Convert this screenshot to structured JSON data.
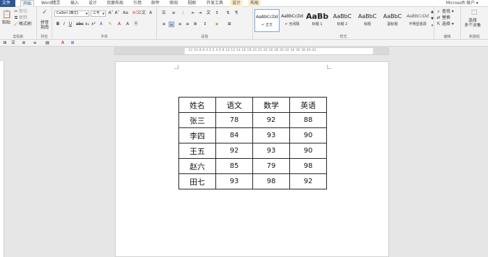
{
  "tabs": [
    {
      "label": "文件",
      "kind": "file"
    },
    {
      "label": "开始",
      "kind": "active"
    },
    {
      "label": "Word精灵",
      "kind": ""
    },
    {
      "label": "插入",
      "kind": ""
    },
    {
      "label": "设计",
      "kind": ""
    },
    {
      "label": "页面布局",
      "kind": ""
    },
    {
      "label": "引用",
      "kind": ""
    },
    {
      "label": "邮件",
      "kind": ""
    },
    {
      "label": "审阅",
      "kind": ""
    },
    {
      "label": "视图",
      "kind": ""
    },
    {
      "label": "开发工具",
      "kind": ""
    },
    {
      "label": "设计",
      "kind": "ctx"
    },
    {
      "label": "布局",
      "kind": "ctx"
    }
  ],
  "account": "Microsoft 帐户 ▾",
  "clipboard": {
    "paste": "粘贴",
    "cut": "剪切",
    "copy": "复制",
    "format_painter": "格式刷",
    "group": "剪贴板"
  },
  "pinyin": {
    "label": "拼音",
    "sub": "指南",
    "group": "拼音"
  },
  "font": {
    "name": "Calibri (西文)",
    "size": "三号",
    "group": "字体"
  },
  "paragraph": {
    "group": "段落"
  },
  "styles": {
    "group": "样式",
    "items": [
      {
        "preview": "AaBbCcDd",
        "name": "↵ 正文"
      },
      {
        "preview": "AaBbCcDd",
        "name": "↵ 无间隔"
      },
      {
        "preview": "AaBb",
        "name": "标题 1"
      },
      {
        "preview": "AaBbC",
        "name": "标题 2"
      },
      {
        "preview": "AaBbC",
        "name": "标题"
      },
      {
        "preview": "AaBbC",
        "name": "副标题"
      },
      {
        "preview": "AaBbCcDd",
        "name": "不明显强调"
      }
    ]
  },
  "editing": {
    "find": "查找 ▾",
    "replace": "替换",
    "select": "选择 ▾",
    "group": "编辑"
  },
  "new_group": {
    "label": "选择",
    "sub": "多个对象",
    "group": "新建组"
  },
  "ruler_ticks": "12  10  8  6  4  2     2  4  6  8  10  12  14  16  18  20  22  24  26  28  30  32  34  36  38  40  42",
  "table": {
    "headers": [
      "姓名",
      "语文",
      "数学",
      "英语"
    ],
    "rows": [
      [
        "张三",
        "78",
        "92",
        "88"
      ],
      [
        "李四",
        "84",
        "93",
        "90"
      ],
      [
        "王五",
        "92",
        "93",
        "90"
      ],
      [
        "赵六",
        "85",
        "79",
        "98"
      ],
      [
        "田七",
        "93",
        "98",
        "92"
      ]
    ]
  },
  "colors": {
    "accent": "#2b579a",
    "ribbon": "#f3f3f3",
    "background": "#e6e6e6",
    "context_tab": "#fbeecb"
  }
}
